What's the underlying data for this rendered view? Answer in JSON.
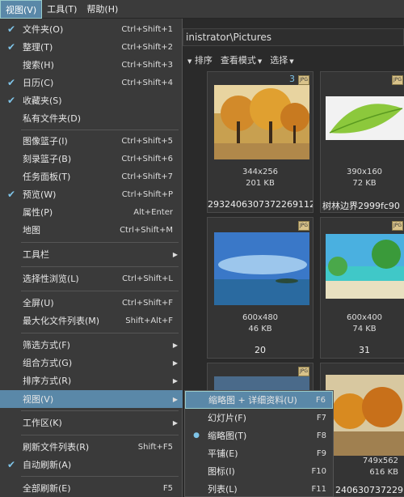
{
  "menubar": {
    "items": [
      {
        "label": "视图(V)",
        "active": true
      },
      {
        "label": "工具(T)",
        "active": false
      },
      {
        "label": "帮助(H)",
        "active": false
      }
    ]
  },
  "background": {
    "path": "inistrator\\Pictures",
    "toolbar": [
      "排序",
      "查看模式",
      "选择"
    ],
    "files": [
      {
        "dims": "344x256",
        "size": "201 KB",
        "name": "2932406307372269112"
      },
      {
        "dims": "390x160",
        "size": "72 KB",
        "name": "树林边界2999fc90"
      },
      {
        "dims": "600x480",
        "size": "46 KB",
        "name": "20"
      },
      {
        "dims": "600x400",
        "size": "74 KB",
        "name": "31"
      },
      {
        "dims": "749x562",
        "size": "616 KB",
        "name": "240630737229"
      }
    ],
    "badge": "3",
    "jpg_label": "JPG"
  },
  "menu": {
    "items": [
      {
        "label": "文件夹(O)",
        "shortcut": "Ctrl+Shift+1",
        "checked": true
      },
      {
        "label": "整理(T)",
        "shortcut": "Ctrl+Shift+2",
        "checked": true
      },
      {
        "label": "搜索(H)",
        "shortcut": "Ctrl+Shift+3",
        "checked": false
      },
      {
        "label": "日历(C)",
        "shortcut": "Ctrl+Shift+4",
        "checked": true
      },
      {
        "label": "收藏夹(S)",
        "shortcut": "",
        "checked": true
      },
      {
        "label": "私有文件夹(D)",
        "shortcut": "",
        "checked": false
      },
      {
        "label": "图像篮子(I)",
        "shortcut": "Ctrl+Shift+5",
        "checked": false
      },
      {
        "label": "刻录篮子(B)",
        "shortcut": "Ctrl+Shift+6",
        "checked": false
      },
      {
        "label": "任务面板(T)",
        "shortcut": "Ctrl+Shift+7",
        "checked": false
      },
      {
        "label": "预览(W)",
        "shortcut": "Ctrl+Shift+P",
        "checked": true
      },
      {
        "label": "属性(P)",
        "shortcut": "Alt+Enter",
        "checked": false
      },
      {
        "label": "地图",
        "shortcut": "Ctrl+Shift+M",
        "checked": false
      },
      {
        "label": "工具栏",
        "shortcut": "",
        "checked": false,
        "submenu": true
      },
      {
        "label": "选择性浏览(L)",
        "shortcut": "Ctrl+Shift+L",
        "checked": false
      },
      {
        "label": "全屏(U)",
        "shortcut": "Ctrl+Shift+F",
        "checked": false
      },
      {
        "label": "最大化文件列表(M)",
        "shortcut": "Shift+Alt+F",
        "checked": false
      },
      {
        "label": "筛选方式(F)",
        "shortcut": "",
        "checked": false,
        "submenu": true
      },
      {
        "label": "组合方式(G)",
        "shortcut": "",
        "checked": false,
        "submenu": true
      },
      {
        "label": "排序方式(R)",
        "shortcut": "",
        "checked": false,
        "submenu": true
      },
      {
        "label": "视图(V)",
        "shortcut": "",
        "checked": false,
        "submenu": true,
        "highlighted": true
      },
      {
        "label": "工作区(K)",
        "shortcut": "",
        "checked": false,
        "submenu": true
      },
      {
        "label": "刷新文件列表(R)",
        "shortcut": "Shift+F5",
        "checked": false
      },
      {
        "label": "自动刷新(A)",
        "shortcut": "",
        "checked": true
      },
      {
        "label": "全部刷新(E)",
        "shortcut": "F5",
        "checked": false
      }
    ]
  },
  "submenu": {
    "items": [
      {
        "label": "缩略图 + 详细资料(U)",
        "shortcut": "F6",
        "highlighted": true,
        "selected": false
      },
      {
        "label": "幻灯片(F)",
        "shortcut": "F7",
        "highlighted": false,
        "selected": false
      },
      {
        "label": "缩略图(T)",
        "shortcut": "F8",
        "highlighted": false,
        "selected": true
      },
      {
        "label": "平铺(E)",
        "shortcut": "F9",
        "highlighted": false,
        "selected": false
      },
      {
        "label": "图标(I)",
        "shortcut": "F10",
        "highlighted": false,
        "selected": false
      },
      {
        "label": "列表(L)",
        "shortcut": "F11",
        "highlighted": false,
        "selected": false
      }
    ]
  },
  "colors": {
    "highlight": "#5a88a8",
    "menu_bg": "#3a3a3a",
    "check": "#7fc4e8"
  }
}
